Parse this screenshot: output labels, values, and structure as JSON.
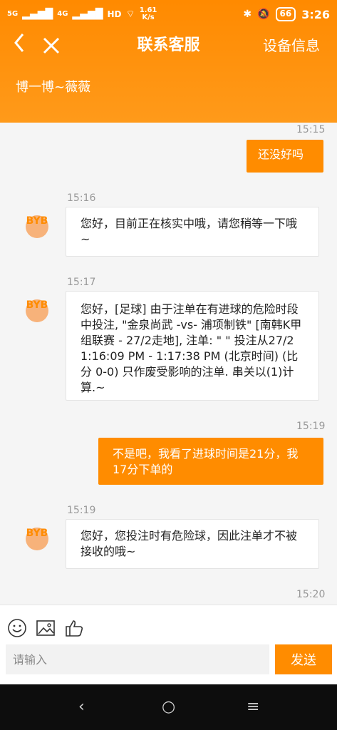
{
  "status": {
    "sig1": "5G",
    "sig2": "4G",
    "speed": "1.61",
    "speed_unit": "K/s",
    "battery": "66",
    "time": "3:26"
  },
  "nav": {
    "back_icon": "back-chevron-icon",
    "close_icon": "close-icon",
    "title": "联系客服",
    "device_info": "设备信息"
  },
  "agent_name": "博一博~薇薇",
  "messages": [
    {
      "time": "15:15",
      "from": "me",
      "text": "还没好吗"
    },
    {
      "time": "15:16",
      "from": "agent",
      "text": "您好，目前正在核实中哦，请您稍等一下哦~"
    },
    {
      "time": "15:17",
      "from": "agent",
      "text": "您好，[足球] 由于注单在有进球的危险时段中投注, \"金泉尚武 -vs- 浦项制铁\" [南韩K甲组联赛 - 27/2走地], 注单: \" \" 投注从27/2 1:16:09 PM - 1:17:38 PM (北京时间) (比分 0-0) 只作废受影响的注单. 串关以(1)计算.~"
    },
    {
      "time": "15:19",
      "from": "me",
      "text": "不是吧，我看了进球时间是21分，我17分下单的"
    },
    {
      "time": "15:19",
      "from": "agent",
      "text": "您好，您投注时有危险球，因此注单才不被接收的哦~"
    },
    {
      "time": "15:20",
      "from": "me",
      "text": ""
    }
  ],
  "avatar_text": "BYB",
  "input": {
    "placeholder": "请输入",
    "send_label": "发送"
  },
  "toolbar_icons": [
    "emoji-icon",
    "image-icon",
    "thumbs-up-icon"
  ],
  "sysnav": {
    "back": "‹",
    "home": "○",
    "menu": "≡"
  },
  "colors": {
    "accent": "#ff8c00",
    "header_bg": "#ff8a00"
  }
}
